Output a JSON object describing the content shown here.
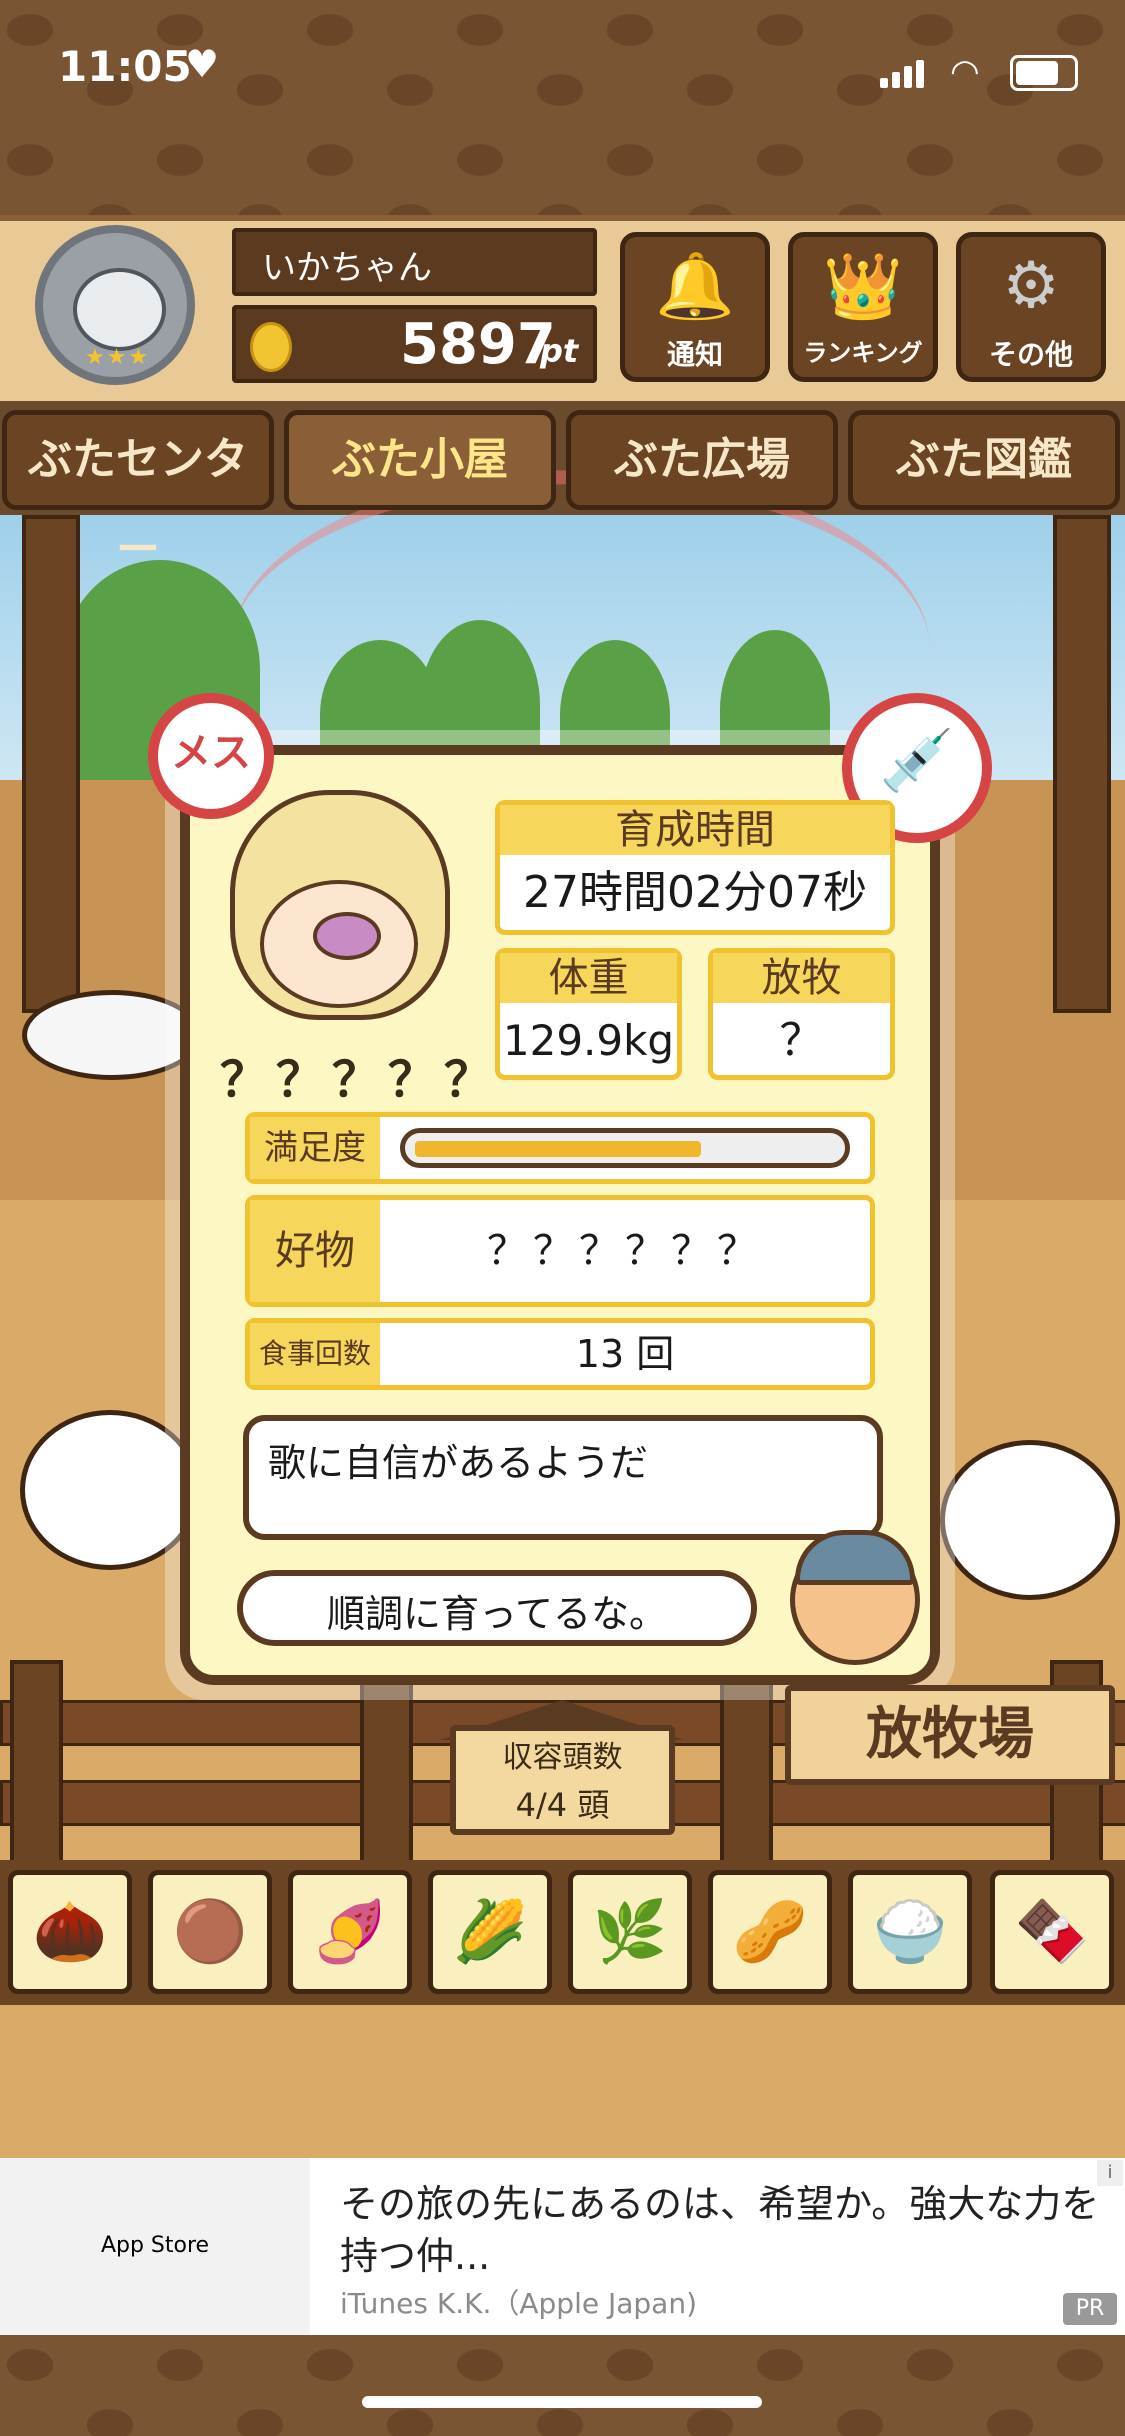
{
  "status_bar": {
    "time": "11:05",
    "heart": "♥",
    "wifi": "wifi-icon"
  },
  "header": {
    "player_name": "いかちゃん",
    "points": "5897",
    "points_unit": "pt",
    "buttons": [
      {
        "label": "通知",
        "icon": "bell-icon",
        "glyph": "🔔"
      },
      {
        "label": "ランキング",
        "icon": "crown-icon",
        "glyph": "👑"
      },
      {
        "label": "その他",
        "icon": "gear-icon",
        "glyph": "⚙"
      }
    ]
  },
  "tabs": [
    {
      "label": "ぶたセンター",
      "active": false
    },
    {
      "label": "ぶた小屋",
      "active": true
    },
    {
      "label": "ぶた広場",
      "active": false
    },
    {
      "label": "ぶた図鑑",
      "active": false
    }
  ],
  "card": {
    "gender_badge": "メス",
    "no_injection_icon": "💉",
    "pig_name": "？？？？？",
    "growth_time_label": "育成時間",
    "growth_time_value": "27時間02分07秒",
    "weight_label": "体重",
    "weight_value": "129.9kg",
    "grazing_label": "放牧",
    "grazing_value": "？",
    "satisfaction_label": "満足度",
    "satisfaction_level": 0.68,
    "favorite_label": "好物",
    "favorite_value": "？？？？？？",
    "meals_label": "食事回数",
    "meals_value": "13 回",
    "comment": "歌に自信があるようだ",
    "farmer_message": "順調に育ってるな。"
  },
  "capacity": {
    "label": "収容頭数",
    "value": "4/4 頭"
  },
  "pasture_sign": "放牧場",
  "foods": [
    "🌰",
    "🟤",
    "🍠",
    "🌽",
    "🌿",
    "🥜",
    "🍚",
    "🍫"
  ],
  "ad": {
    "store": " App Store",
    "text": "その旅の先にあるのは、希望か。強大な力を持つ仲...",
    "advertiser": "iTunes K.K.（Apple Japan)",
    "pr": "PR",
    "info": "i"
  },
  "colors": {
    "wood_dark": "#5a3a20",
    "card_bg": "#fdf7c3",
    "accent_yellow": "#f7d65c",
    "badge_red": "#d64545"
  }
}
